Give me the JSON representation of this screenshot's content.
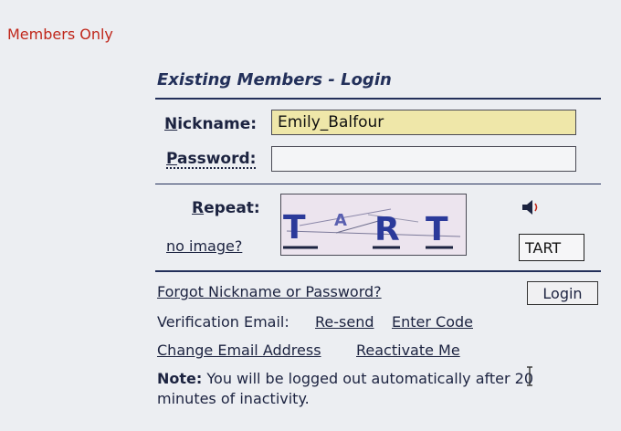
{
  "header": {
    "members_only": "Members Only"
  },
  "login": {
    "title": "Existing Members - Login",
    "nickname": {
      "label_initial": "N",
      "label_rest": "ickname:",
      "value": "Emily_Balfour"
    },
    "password": {
      "label_initial": "P",
      "label_rest": "assword:",
      "value": ""
    },
    "captcha": {
      "label_initial": "R",
      "label_rest": "epeat:",
      "image_text": [
        "T",
        "A",
        "R",
        "T"
      ],
      "no_image_link": "no image?",
      "answer_value": "TART",
      "speaker_icon": "speaker-icon"
    },
    "forgot_link": "Forgot Nickname or Password?",
    "login_button": "Login",
    "verification": {
      "label": "Verification Email:",
      "resend": "Re-send",
      "enter_code": "Enter Code"
    },
    "change_email": "Change Email Address",
    "reactivate": "Reactivate Me",
    "note": {
      "label": "Note:",
      "text": "You will be logged out automatically after 20 minutes of inactivity."
    }
  },
  "colors": {
    "accent_red": "#c0271b",
    "navy": "#23305a",
    "filled_input": "#efe7a9"
  }
}
